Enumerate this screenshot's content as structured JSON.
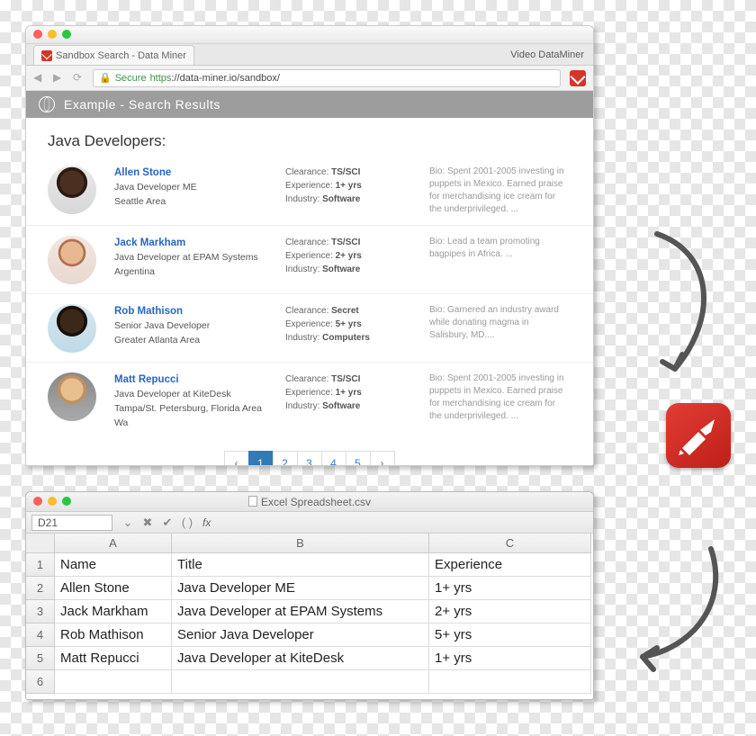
{
  "browser": {
    "tab_title": "Sandbox Search - Data Miner",
    "video_link": "Video DataMiner",
    "secure_label": "Secure",
    "url_https": "https",
    "url_rest": "://data-miner.io/sandbox/",
    "banner": "Example  -  Search Results",
    "heading": "Java Developers:"
  },
  "results": [
    {
      "name": "Allen Stone",
      "title": "Java Developer ME",
      "loc": "Seattle Area",
      "clear_l": "Clearance:",
      "clear_v": "TS/SCI",
      "exp_l": "Experience:",
      "exp_v": "1+ yrs",
      "ind_l": "Industry:",
      "ind_v": "Software",
      "bio": "Bio: Spent 2001-2005 investing in puppets in Mexico. Earned praise for merchandising ice cream for the underprivileged. ..."
    },
    {
      "name": "Jack Markham",
      "title": "Java Developer at EPAM Systems",
      "loc": "Argentina",
      "clear_l": "Clearance:",
      "clear_v": "TS/SCI",
      "exp_l": "Experience:",
      "exp_v": "2+ yrs",
      "ind_l": "Industry:",
      "ind_v": "Software",
      "bio": "Bio: Lead a team promoting bagpipes in Africa. ..."
    },
    {
      "name": "Rob Mathison",
      "title": "Senior Java Developer",
      "loc": "Greater Atlanta Area",
      "clear_l": "Clearance:",
      "clear_v": "Secret",
      "exp_l": "Experience:",
      "exp_v": "5+ yrs",
      "ind_l": "Industry:",
      "ind_v": "Computers",
      "bio": "Bio: Garnered an industry award while donating magma in Salisbury, MD...."
    },
    {
      "name": "Matt Repucci",
      "title": "Java Developer at KiteDesk",
      "loc": "Tampa/St. Petersburg, Florida Area Wa",
      "clear_l": "Clearance:",
      "clear_v": "TS/SCI",
      "exp_l": "Experience:",
      "exp_v": "1+ yrs",
      "ind_l": "Industry:",
      "ind_v": "Software",
      "bio": "Bio: Spent 2001-2005 investing in puppets in Mexico. Earned praise for merchandising ice cream for the underprivileged. ..."
    }
  ],
  "pager": {
    "prev": "‹",
    "p1": "1",
    "p2": "2",
    "p3": "3",
    "p4": "4",
    "p5": "5",
    "next": "›"
  },
  "excel": {
    "filename": "Excel Spreadsheet.csv",
    "cellref": "D21",
    "fx": "fx",
    "cols": {
      "A": "A",
      "B": "B",
      "C": "C"
    },
    "rows": {
      "r1": "1",
      "r2": "2",
      "r3": "3",
      "r4": "4",
      "r5": "5",
      "r6": "6"
    },
    "header": {
      "name": "Name",
      "title": "Title",
      "exp": "Experience"
    },
    "data": [
      {
        "name": "Allen Stone",
        "title": "Java Developer ME",
        "exp": "1+ yrs"
      },
      {
        "name": "Jack Markham",
        "title": "Java Developer at EPAM Systems",
        "exp": "2+ yrs"
      },
      {
        "name": "Rob Mathison",
        "title": "Senior Java Developer",
        "exp": "5+ yrs"
      },
      {
        "name": "Matt Repucci",
        "title": "Java Developer at KiteDesk",
        "exp": "1+ yrs"
      }
    ]
  }
}
